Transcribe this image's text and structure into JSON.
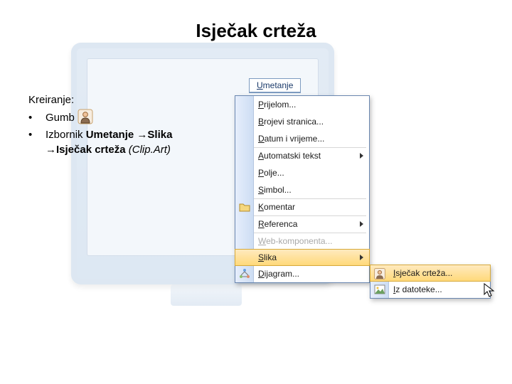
{
  "title": "Isječak crteža",
  "content": {
    "heading": "Kreiranje:",
    "bullets": [
      {
        "label": "Gumb"
      },
      {
        "prefix": "Izbornik ",
        "strong1": "Umetanje ",
        "arrow1": "→",
        "strong2": "Slika",
        "arrow2": "→",
        "strong3": "Isječak crteža ",
        "italicSuffix": "(Clip.Art)"
      }
    ]
  },
  "menuBar": {
    "label": "Umetanje"
  },
  "dropdown": [
    {
      "label": "Prijelom...",
      "hasArrow": false
    },
    {
      "label": "Brojevi stranica...",
      "hasArrow": false
    },
    {
      "label": "Datum i vrijeme...",
      "hasArrow": false,
      "sepAfter": true
    },
    {
      "label": "Automatski tekst",
      "hasArrow": true
    },
    {
      "label": "Polje...",
      "hasArrow": false
    },
    {
      "label": "Simbol...",
      "hasArrow": false,
      "sepAfter": true
    },
    {
      "label": "Komentar",
      "hasArrow": false,
      "icon": "folder",
      "sepAfter": true
    },
    {
      "label": "Referenca",
      "hasArrow": true,
      "sepAfter": true
    },
    {
      "label": "Web-komponenta...",
      "hasArrow": false,
      "disabled": true,
      "sepAfter": true
    },
    {
      "label": "Slika",
      "hasArrow": true,
      "highlight": true
    },
    {
      "label": "Dijagram...",
      "hasArrow": false,
      "icon": "diagram"
    }
  ],
  "submenu": [
    {
      "label": "Isječak crteža...",
      "highlight": true,
      "icon": "avatar"
    },
    {
      "label": "Iz datoteke...",
      "icon": "image"
    }
  ]
}
